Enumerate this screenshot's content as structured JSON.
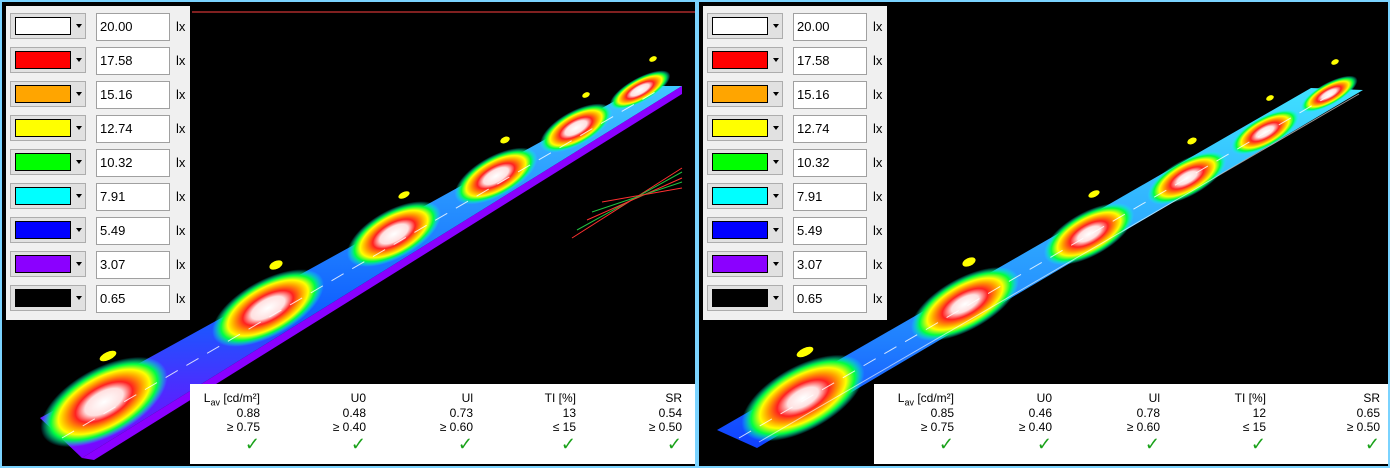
{
  "legend": [
    {
      "color": "#ffffff",
      "value": "20.00",
      "unit": "lx"
    },
    {
      "color": "#ff0000",
      "value": "17.58",
      "unit": "lx"
    },
    {
      "color": "#ffa500",
      "value": "15.16",
      "unit": "lx"
    },
    {
      "color": "#ffff00",
      "value": "12.74",
      "unit": "lx"
    },
    {
      "color": "#00ff00",
      "value": "10.32",
      "unit": "lx"
    },
    {
      "color": "#00ffff",
      "value": "7.91",
      "unit": "lx"
    },
    {
      "color": "#0000ff",
      "value": "5.49",
      "unit": "lx"
    },
    {
      "color": "#8b00ff",
      "value": "3.07",
      "unit": "lx"
    },
    {
      "color": "#000000",
      "value": "0.65",
      "unit": "lx"
    }
  ],
  "results_headers": {
    "lav_main": "L",
    "lav_sub": "av",
    "lav_unit": " [cd/m²]",
    "u0": "U0",
    "ul": "Ul",
    "ti": "TI [%]",
    "sr": "SR"
  },
  "panels": [
    {
      "values": {
        "lav": "0.88",
        "u0": "0.48",
        "ul": "0.73",
        "ti": "13",
        "sr": "0.54"
      },
      "limits": {
        "lav": "≥ 0.75",
        "u0": "≥ 0.40",
        "ul": "≥ 0.60",
        "ti": "≤ 15",
        "sr": "≥ 0.50"
      },
      "pass_mark": "✓"
    },
    {
      "values": {
        "lav": "0.85",
        "u0": "0.46",
        "ul": "0.78",
        "ti": "12",
        "sr": "0.65"
      },
      "limits": {
        "lav": "≥ 0.75",
        "u0": "≥ 0.40",
        "ul": "≥ 0.60",
        "ti": "≤ 15",
        "sr": "≥ 0.50"
      },
      "pass_mark": "✓"
    }
  ]
}
